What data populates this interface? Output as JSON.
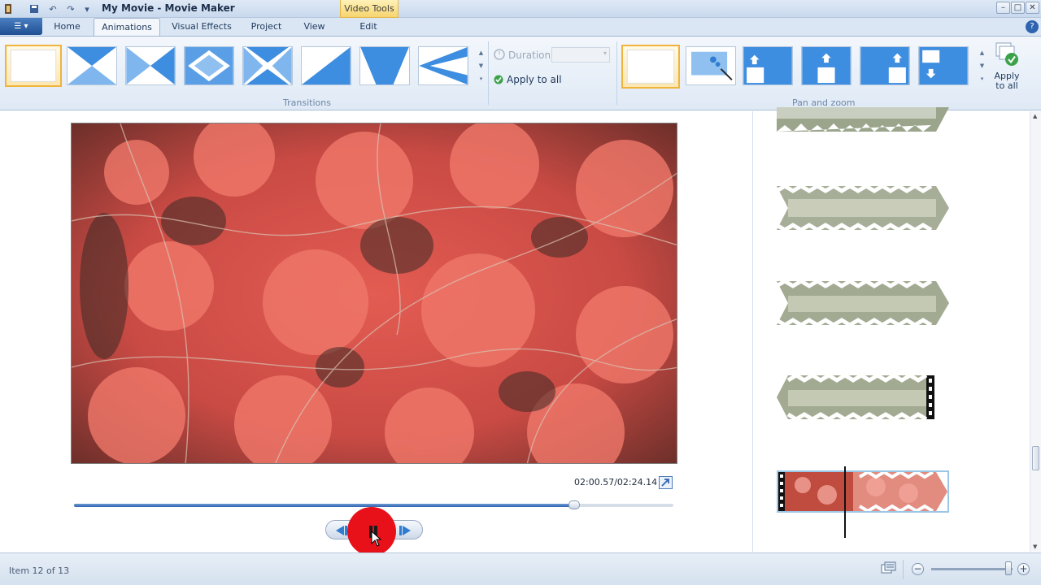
{
  "window": {
    "title": "My Movie - Movie Maker",
    "contextual_tab": "Video Tools"
  },
  "tabs": [
    {
      "label": "Home"
    },
    {
      "label": "Animations"
    },
    {
      "label": "Visual Effects"
    },
    {
      "label": "Project"
    },
    {
      "label": "View"
    },
    {
      "label": "Edit"
    }
  ],
  "active_tab": "Animations",
  "ribbon": {
    "transitions": {
      "group_label": "Transitions",
      "duration_label": "Duration:",
      "duration_value": "",
      "apply_all_label": "Apply to all"
    },
    "pan_zoom": {
      "group_label": "Pan and zoom",
      "apply_to_all_label": "Apply to all"
    }
  },
  "preview": {
    "timecode": "02:00.57/02:24.14",
    "progress_fraction": 0.835
  },
  "status": {
    "item_text": "Item 12 of 13"
  },
  "icons": {
    "app_menu": "app-menu-icon",
    "fullscreen": "fullscreen-icon",
    "previous_frame": "previous-frame-icon",
    "pause": "pause-icon",
    "next_frame": "next-frame-icon",
    "zoom_out": "zoom-out-icon",
    "zoom_in": "zoom-in-icon"
  },
  "colors": {
    "accent": "#2f64b0",
    "selection": "#f0b33c",
    "cursor_highlight": "#e8111a",
    "leaves": "#e1584d"
  }
}
